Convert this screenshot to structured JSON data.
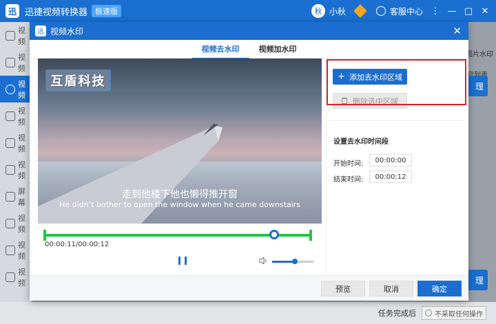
{
  "app": {
    "logo": "迅",
    "title": "迅捷视频转换器",
    "badge": "极速版",
    "user_initial": "秋",
    "user_name": "小秋",
    "customer_service": "客服中心",
    "menu_glyph": "⋮",
    "minimize_glyph": "—",
    "maximize_glyph": "□",
    "close_glyph": "✕"
  },
  "sidebar": {
    "items": [
      {
        "label": "视频",
        "active": false
      },
      {
        "label": "视频",
        "active": false
      },
      {
        "label": "视频",
        "active": true
      },
      {
        "label": "视频",
        "active": false
      },
      {
        "label": "视频",
        "active": false
      },
      {
        "label": "视频",
        "active": false
      },
      {
        "label": "屏幕",
        "active": false
      },
      {
        "label": "视频",
        "active": false
      },
      {
        "label": "视频",
        "active": false
      },
      {
        "label": "视频",
        "active": false
      }
    ]
  },
  "background": {
    "right_label_top": "加图片水印",
    "right_label_second": "清空列表",
    "process_label": "理",
    "process_label_bottom": "理",
    "task_done_label": "任务完成后",
    "task_done_value": "不采取任何操作"
  },
  "modal": {
    "logo": "迅",
    "title": "视频水印",
    "close_glyph": "✕",
    "tabs": [
      {
        "label": "视频去水印",
        "active": true
      },
      {
        "label": "视频加水印",
        "active": false
      }
    ],
    "video": {
      "watermark_text": "互盾科技",
      "subtitle_cn": "走到他楼下他也懒得推开窗",
      "subtitle_en": "He didn’t bother to open the window when he came downstairs",
      "time_display": "00:00:11/00:00:12",
      "progress": 0.86,
      "volume": 0.55
    },
    "panel": {
      "add_region_label": "添加去水印区域",
      "add_glyph": "+",
      "delete_region_label": "删除选中区域",
      "section_title": "设置去水印时间段",
      "start_label": "开始时间:",
      "start_value": "00:00:00",
      "end_label": "结束时间:",
      "end_value": "00:00:12"
    },
    "footer": {
      "preview_label": "预览",
      "cancel_label": "取消",
      "confirm_label": "确定"
    }
  }
}
